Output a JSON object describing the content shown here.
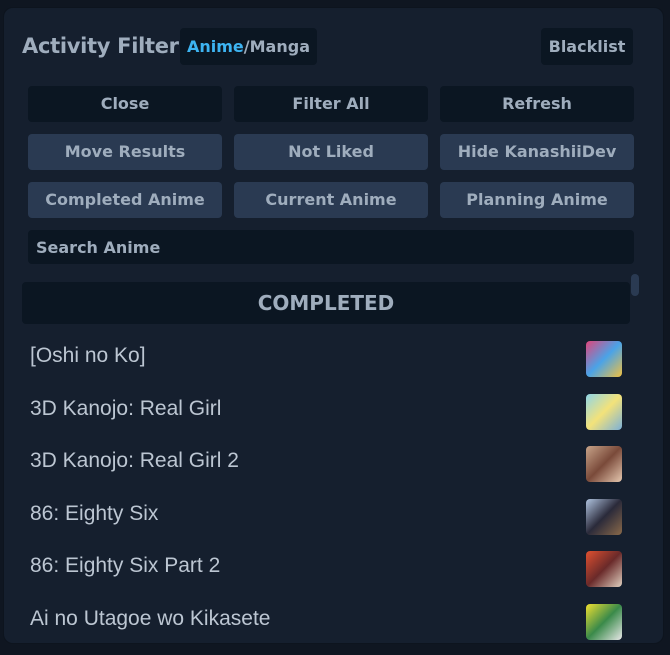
{
  "header": {
    "title": "Activity Filter",
    "mode_active": "Anime",
    "mode_sep": "/",
    "mode_inactive": "Manga",
    "blacklist_label": "Blacklist"
  },
  "buttons": {
    "close": "Close",
    "filter_all": "Filter All",
    "refresh": "Refresh",
    "move_results": "Move Results",
    "not_liked": "Not Liked",
    "hide_user": "Hide KanashiiDev",
    "completed": "Completed Anime",
    "current": "Current Anime",
    "planning": "Planning Anime"
  },
  "search": {
    "placeholder": "Search Anime"
  },
  "section": {
    "title": "COMPLETED"
  },
  "items": [
    {
      "name": "[Oshi no Ko]",
      "colors": [
        "#e0457b",
        "#4aa3e8",
        "#f0c040"
      ]
    },
    {
      "name": "3D Kanojo: Real Girl",
      "colors": [
        "#8fd6e8",
        "#f3e27a",
        "#7bb0d8"
      ]
    },
    {
      "name": "3D Kanojo: Real Girl 2",
      "colors": [
        "#c8a48a",
        "#7a4a3a",
        "#e6c8b0"
      ]
    },
    {
      "name": "86: Eighty Six",
      "colors": [
        "#b0c4e0",
        "#2a2a3a",
        "#8a6a4a"
      ]
    },
    {
      "name": "86: Eighty Six Part 2",
      "colors": [
        "#e05030",
        "#6a2a2a",
        "#e0d0c0"
      ]
    },
    {
      "name": "Ai no Utagoe wo Kikasete",
      "colors": [
        "#f0e030",
        "#3a8a4a",
        "#e8e8e8"
      ]
    }
  ]
}
